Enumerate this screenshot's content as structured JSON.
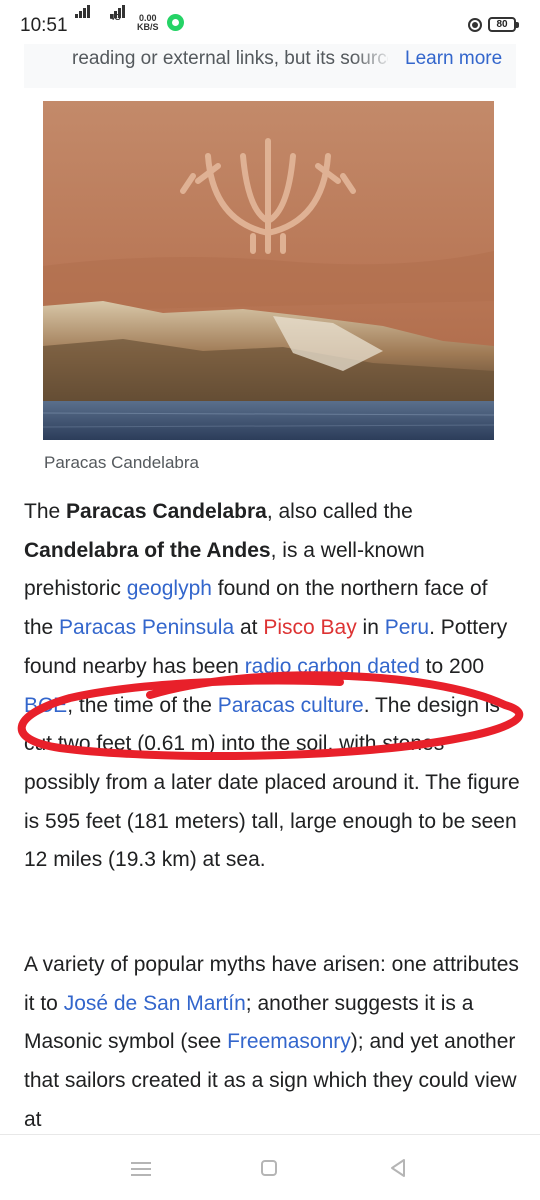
{
  "status_bar": {
    "time": "10:51",
    "network_tag_1": "4G",
    "speed_value": "0.00",
    "speed_unit": "KB/S",
    "battery": "80"
  },
  "notice": {
    "text": "reading or external links, but its sources",
    "link": "Learn more"
  },
  "figure": {
    "caption": "Paracas Candelabra"
  },
  "article": {
    "p1": [
      {
        "t": "The "
      },
      {
        "t": "Paracas Candelabra",
        "b": true
      },
      {
        "t": ", also called the "
      },
      {
        "t": "Candelabra of the Andes",
        "b": true
      },
      {
        "t": ", is a well-known prehistoric "
      },
      {
        "t": "geoglyph",
        "link": true
      },
      {
        "t": " found on the northern face of the "
      },
      {
        "t": "Paracas Peninsula",
        "link": true
      },
      {
        "t": " at "
      },
      {
        "t": "Pisco Bay",
        "link": "new"
      },
      {
        "t": " in "
      },
      {
        "t": "Peru",
        "link": true
      },
      {
        "t": ". Pottery found nearby has been "
      },
      {
        "t": "radio carbon dated",
        "link": true
      },
      {
        "t": " to 200 "
      },
      {
        "t": "BCE",
        "link": true
      },
      {
        "t": ", the time of the "
      },
      {
        "t": "Paracas culture",
        "link": true
      },
      {
        "t": ". The design is cut two feet (0.61 m) into the soil, with stones possibly from a later date placed around it. The figure is 595 feet (181 meters) tall, large enough to be seen 12 miles (19.3 km) at sea."
      }
    ],
    "p2": [
      {
        "t": "A variety of popular myths have arisen: one attributes it to "
      },
      {
        "t": "José de San Martín",
        "link": true
      },
      {
        "t": "; another suggests it is a Masonic symbol (see "
      },
      {
        "t": "Freemasonry",
        "link": true
      },
      {
        "t": "); and yet another that sailors created it as a sign which they could view at"
      }
    ]
  },
  "colors": {
    "link": "#3366cc",
    "new_link": "#d33",
    "annotation": "#e8202a",
    "text": "#202122"
  },
  "icons": [
    "signal-icon",
    "whatsapp-icon",
    "battery-icon",
    "menu-icon",
    "home-icon",
    "back-icon"
  ]
}
